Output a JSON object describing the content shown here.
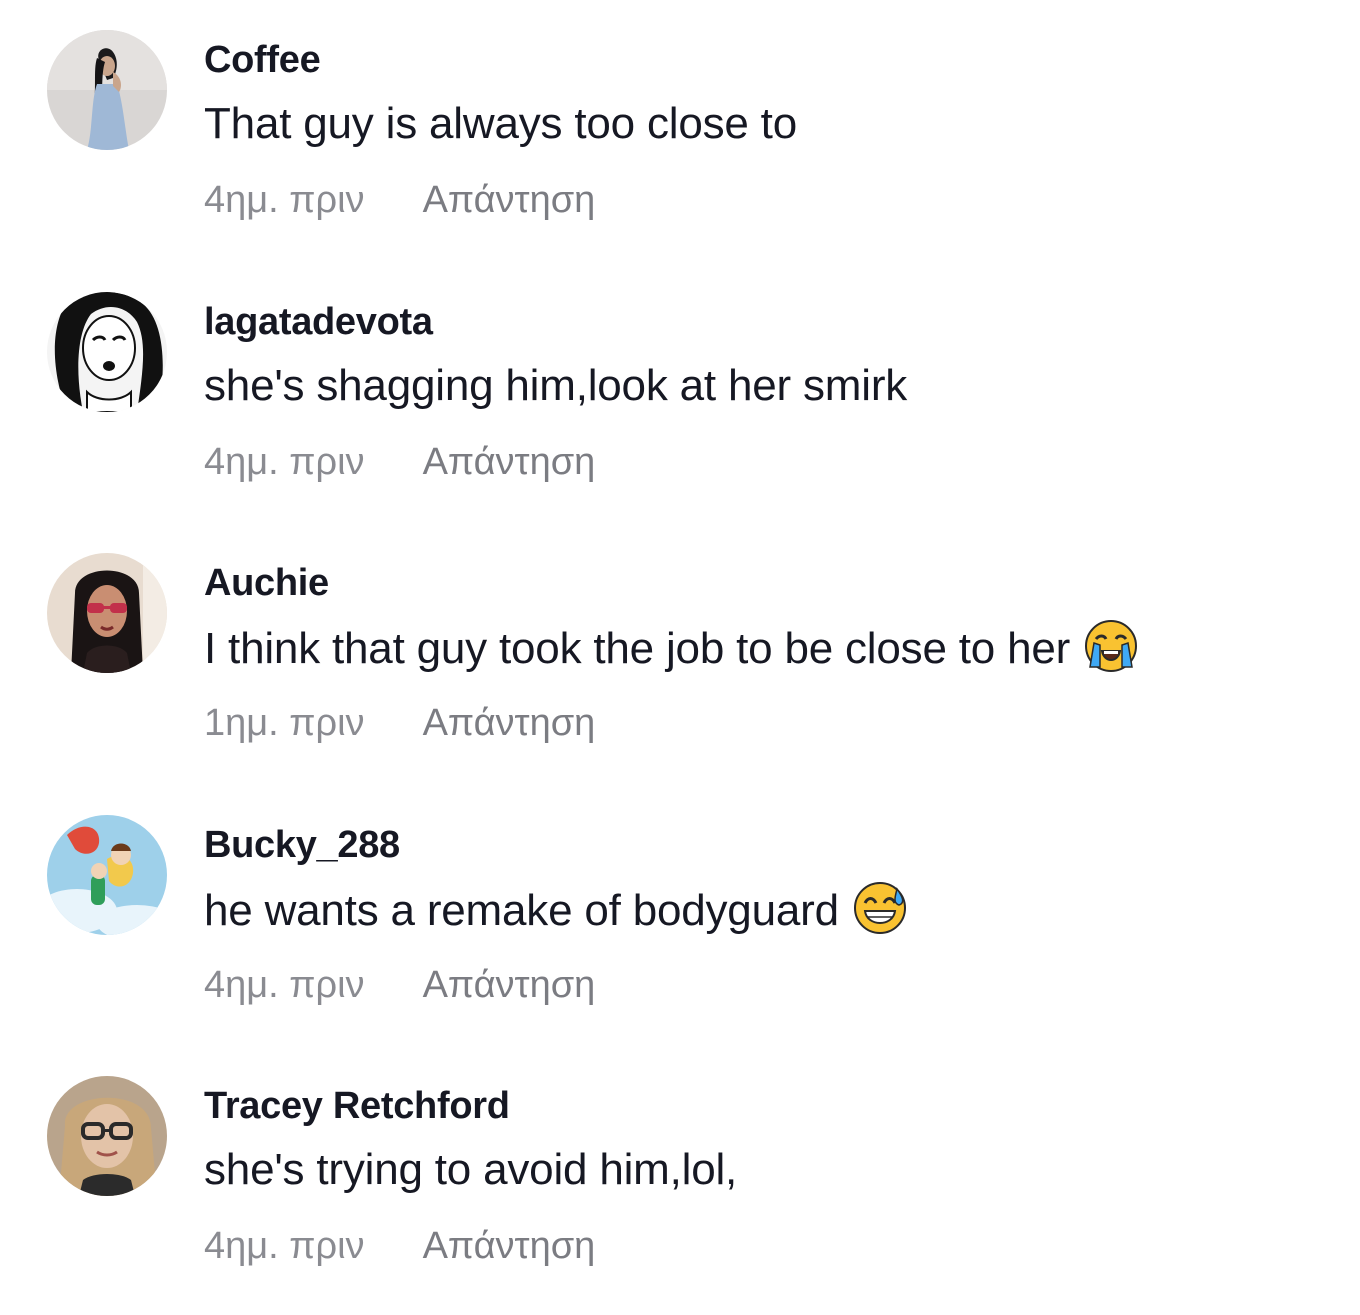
{
  "comments": [
    {
      "username": "Coffee",
      "text": "That guy is always too close to",
      "time": "4ημ. πριν",
      "reply": "Απάντηση",
      "avatar_icon": "user-avatar-woman-posing"
    },
    {
      "username": "lagatadevota",
      "text": "she's shagging him,look at her smirk",
      "time": "4ημ. πριν",
      "reply": "Απάντηση",
      "avatar_icon": "user-avatar-sketch-portrait"
    },
    {
      "username": "Auchie",
      "text": "I think that guy took the job to be close to her",
      "time": "1ημ. πριν",
      "reply": "Απάντηση",
      "emoji": "loudly-crying-face",
      "avatar_icon": "user-avatar-woman-sunglasses"
    },
    {
      "username": "Bucky_288",
      "text": "he wants a remake of bodyguard",
      "time": "4ημ. πριν",
      "reply": "Απάντηση",
      "emoji": "grinning-face-with-sweat",
      "avatar_icon": "user-avatar-anime-illustration"
    },
    {
      "username": "Tracey Retchford",
      "text": "she's trying to avoid him,lol,",
      "time": "4ημ. πριν",
      "reply": "Απάντηση",
      "avatar_icon": "user-avatar-woman-glasses"
    }
  ],
  "colors": {
    "text_primary": "#161823",
    "text_secondary": "#8a8b91"
  }
}
